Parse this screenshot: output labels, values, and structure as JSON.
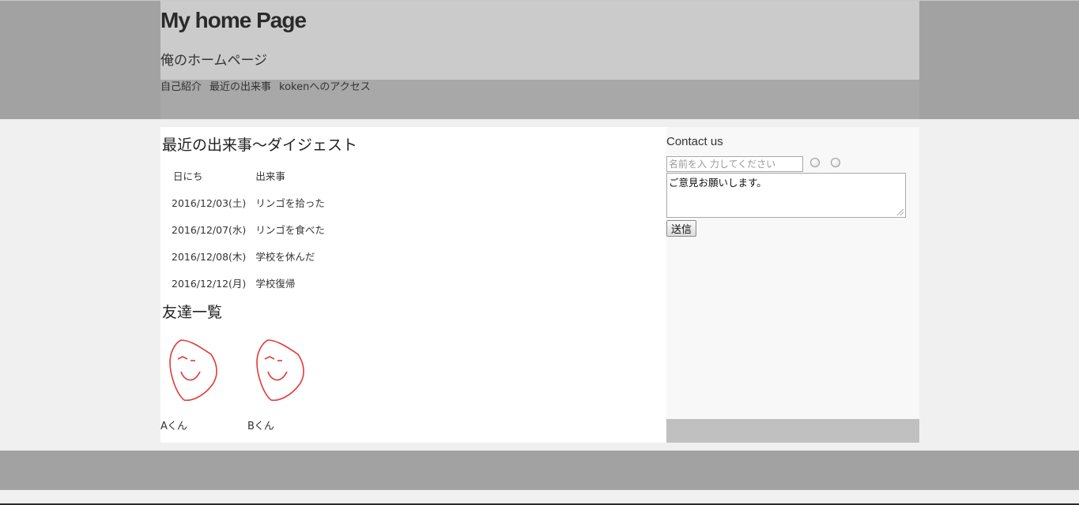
{
  "header": {
    "title": "My home Page",
    "subtitle": "俺のホームページ"
  },
  "nav": {
    "items": [
      {
        "label": "自己紹介"
      },
      {
        "label": "最近の出来事"
      },
      {
        "label": "kokenへのアクセス"
      }
    ]
  },
  "main": {
    "events_heading": "最近の出来事〜ダイジェスト",
    "events_table": {
      "headers": [
        "日にち",
        "出来事"
      ],
      "rows": [
        [
          "2016/12/03(土)",
          "リンゴを拾った"
        ],
        [
          "2016/12/07(水)",
          "リンゴを食べた"
        ],
        [
          "2016/12/08(木)",
          "学校を休んだ"
        ],
        [
          "2016/12/12(月)",
          "学校復帰"
        ]
      ]
    },
    "friends_heading": "友達一覧",
    "friends": [
      {
        "name": "Aくん",
        "icon": "smiley-face-drawing"
      },
      {
        "name": "Bくん",
        "icon": "smiley-face-drawing"
      }
    ]
  },
  "sidebar": {
    "contact_title": "Contact us",
    "name_placeholder": "名前を入 力してください",
    "message_value": "ご意見お願いします。",
    "send_label": "送信"
  },
  "colors": {
    "header_band": "#a2a2a2",
    "header_inner": "#cbcbcb",
    "nav_inner": "#a8a8a8",
    "main_bg": "#ffffff",
    "sidebar_bg": "#f8f8f8",
    "sidebar_bottom": "#c0c0c0",
    "footer": "#a2a2a2",
    "face_stroke": "#e03a3a"
  }
}
